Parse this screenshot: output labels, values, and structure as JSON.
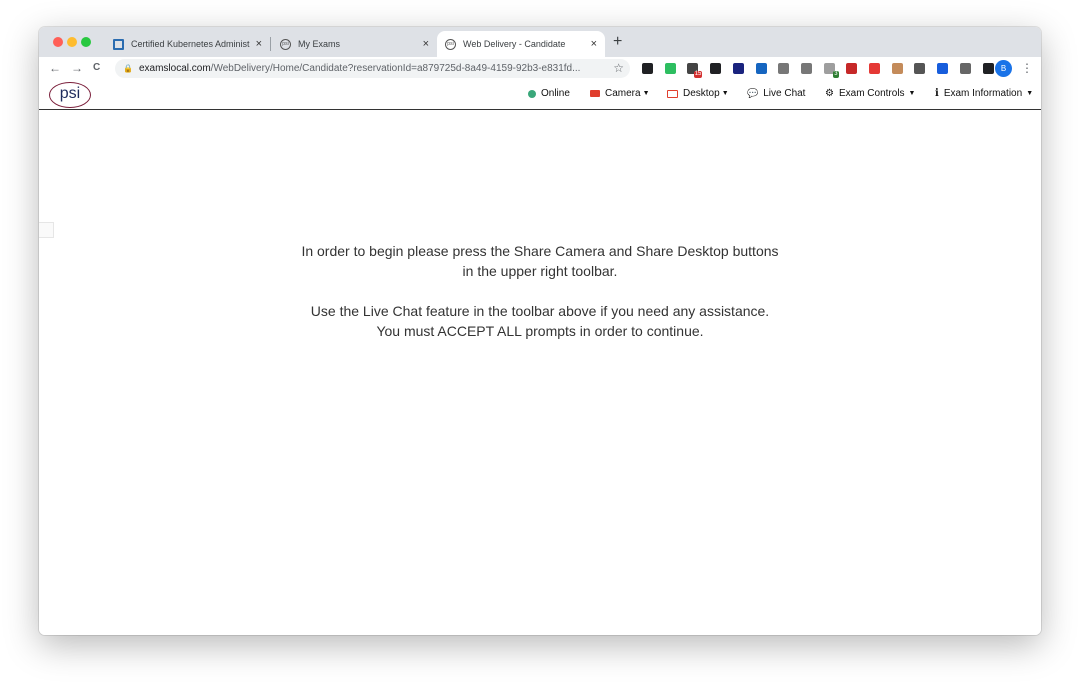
{
  "browser": {
    "tabs": [
      {
        "title": "Certified Kubernetes Administ",
        "icon": "kubernetes-favicon"
      },
      {
        "title": "My Exams",
        "icon": "psi-favicon"
      },
      {
        "title": "Web Delivery - Candidate",
        "icon": "psi-favicon",
        "active": true
      }
    ],
    "close_glyph": "×",
    "new_tab_glyph": "+",
    "nav": {
      "back": "←",
      "forward": "→",
      "reload": "C"
    },
    "url_domain": "examslocal.com",
    "url_path": "/WebDelivery/Home/Candidate?reservationId=a879725d-8a49-4159-92b3-e831fd...",
    "star_glyph": "☆",
    "profile_initial": "B",
    "extensions": [
      {
        "name": "bookmark-icon",
        "color": "#202124"
      },
      {
        "name": "evernote-icon",
        "color": "#2dbe60"
      },
      {
        "name": "notification-icon",
        "color": "#444444",
        "badge": "15"
      },
      {
        "name": "download-icon",
        "color": "#202124"
      },
      {
        "name": "target-icon",
        "color": "#1a237e"
      },
      {
        "name": "y-icon",
        "color": "#1565c0"
      },
      {
        "name": "search-icon",
        "color": "#777777"
      },
      {
        "name": "puzzle-outline-icon",
        "color": "#777777"
      },
      {
        "name": "message-icon",
        "color": "#9e9e9e",
        "badge": "3"
      },
      {
        "name": "flag-icon",
        "color": "#c62828"
      },
      {
        "name": "opera-icon",
        "color": "#e53935"
      },
      {
        "name": "box-icon",
        "color": "#c48b5a"
      },
      {
        "name": "recycle-icon",
        "color": "#555555"
      },
      {
        "name": "bitwarden-icon",
        "color": "#175ddc"
      },
      {
        "name": "edit-icon",
        "color": "#666666"
      },
      {
        "name": "extensions-icon",
        "color": "#202124"
      }
    ]
  },
  "site": {
    "logo_text": "psi",
    "menu": {
      "online": "Online",
      "camera": "Camera",
      "desktop": "Desktop",
      "live_chat": "Live Chat",
      "exam_controls": "Exam Controls",
      "exam_information": "Exam Information"
    },
    "colors": {
      "online": "#3aa77a",
      "alert": "#e03e2d",
      "logo_ring": "#7a1e3a",
      "logo_text": "#1e2b5c"
    }
  },
  "content": {
    "line1": "In order to begin please press the Share Camera and Share Desktop buttons",
    "line2": "in the upper right toolbar.",
    "line3": "Use the Live Chat feature in the toolbar above if you need any assistance.",
    "line4": "You must ACCEPT ALL prompts in order to continue."
  }
}
